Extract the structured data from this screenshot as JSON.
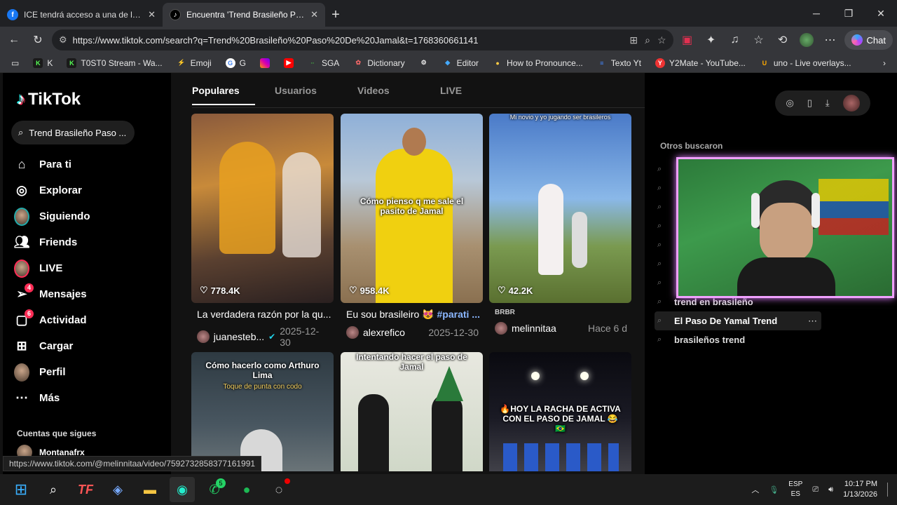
{
  "tabs": [
    {
      "title": "ICE tendrá acceso a una de las her",
      "favicon": "f",
      "favicon_color": "#1877f2"
    },
    {
      "title": "Encuentra 'Trend Brasileño Paso De",
      "favicon": "♪",
      "favicon_color": "#000000"
    }
  ],
  "url": "https://www.tiktok.com/search?q=Trend%20Brasileño%20Paso%20De%20Jamal&t=1768360661141",
  "chat_label": "Chat",
  "bookmarks": [
    "K",
    "T0ST0 Stream - Wa...",
    "Emoji",
    "G",
    "",
    "",
    "SGA",
    "Dictionary",
    "",
    "Editor",
    "How to Pronounce...",
    "Texto Yt",
    "Y2Mate - YouTube...",
    "uno - Live overlays..."
  ],
  "tiktok": {
    "logo": "TikTok",
    "search_query": "Trend Brasileño Paso ...",
    "nav": [
      "Para ti",
      "Explorar",
      "Siguiendo",
      "Friends",
      "LIVE",
      "Mensajes",
      "Actividad",
      "Cargar",
      "Perfil",
      "Más"
    ],
    "badges": {
      "mensajes": "4",
      "actividad": "6"
    },
    "following_header": "Cuentas que sigues",
    "following_user": "Montanafrx",
    "result_tabs": [
      "Populares",
      "Usuarios",
      "Videos",
      "LIVE"
    ],
    "videos": [
      {
        "likes": "778.4K",
        "desc": "La verdadera razón por la qu...",
        "user": "juanesteb...",
        "date": "2025-12-30",
        "caption": ""
      },
      {
        "likes": "958.4K",
        "desc": "Eu sou brasileiro 😻 ",
        "tag": "#parati ...",
        "user": "alexrefico",
        "date": "2025-12-30",
        "caption": "Cómo pienso q me sale el pasito de Jamal"
      },
      {
        "likes": "42.2K",
        "desc": "BRBR",
        "user": "melinnitaa",
        "date": "Hace 6 d",
        "caption": "Mi novio y yo jugando ser brasileros"
      },
      {
        "caption": "Cómo hacerlo como Arthuro Lima",
        "subcaption": "Toque de punta con codo"
      },
      {
        "caption": "Intentando hacer el paso de Jamal"
      },
      {
        "caption": "🔥HOY LA RACHA DE ACTIVA CON EL PASO DE JAMAL 😂🇧🇷"
      }
    ],
    "others_header": "Otros buscaron",
    "others": [
      "trend en brasileño",
      "El Paso De Yamal Trend",
      "brasileños trend"
    ]
  },
  "status_url": "https://www.tiktok.com/@melinnitaa/video/7592732858377161991",
  "taskbar": {
    "whatsapp_badge": "5",
    "lang1": "ESP",
    "lang2": "ES",
    "time": "10:17 PM",
    "date": "1/13/2026"
  }
}
